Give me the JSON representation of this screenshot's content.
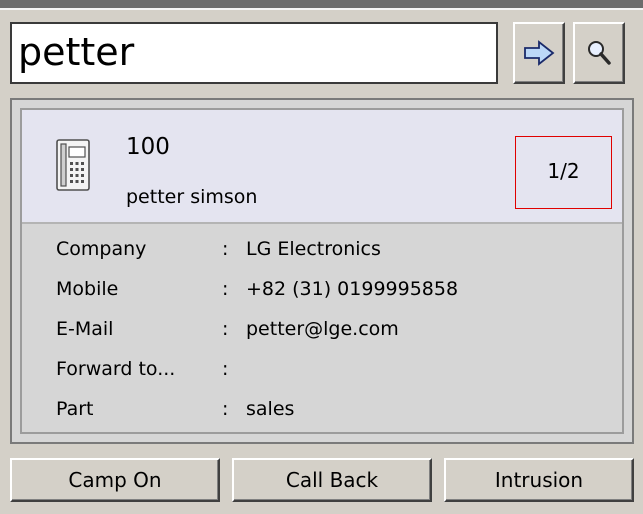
{
  "search": {
    "value": "petter"
  },
  "buttons": {
    "go_icon": "arrow-right-icon",
    "search_icon": "magnifier-icon"
  },
  "contact": {
    "icon": "desk-phone-icon",
    "extension": "100",
    "name": "petter simson",
    "page": "1/2",
    "details": [
      {
        "label": "Company",
        "sep": ":",
        "value": "LG Electronics"
      },
      {
        "label": "Mobile",
        "sep": ":",
        "value": "+82 (31) 0199995858"
      },
      {
        "label": "E-Mail",
        "sep": ":",
        "value": "petter@lge.com"
      },
      {
        "label": "Forward to...",
        "sep": ":",
        "value": ""
      },
      {
        "label": "Part",
        "sep": ":",
        "value": "sales"
      }
    ]
  },
  "actions": {
    "camp_on": "Camp On",
    "call_back": "Call Back",
    "intrusion": "Intrusion"
  },
  "colors": {
    "background": "#d4d0c8",
    "header": "#e4e4f0",
    "page_indicator_border": "#e00000",
    "arrow_fill": "#bcd8f8"
  }
}
